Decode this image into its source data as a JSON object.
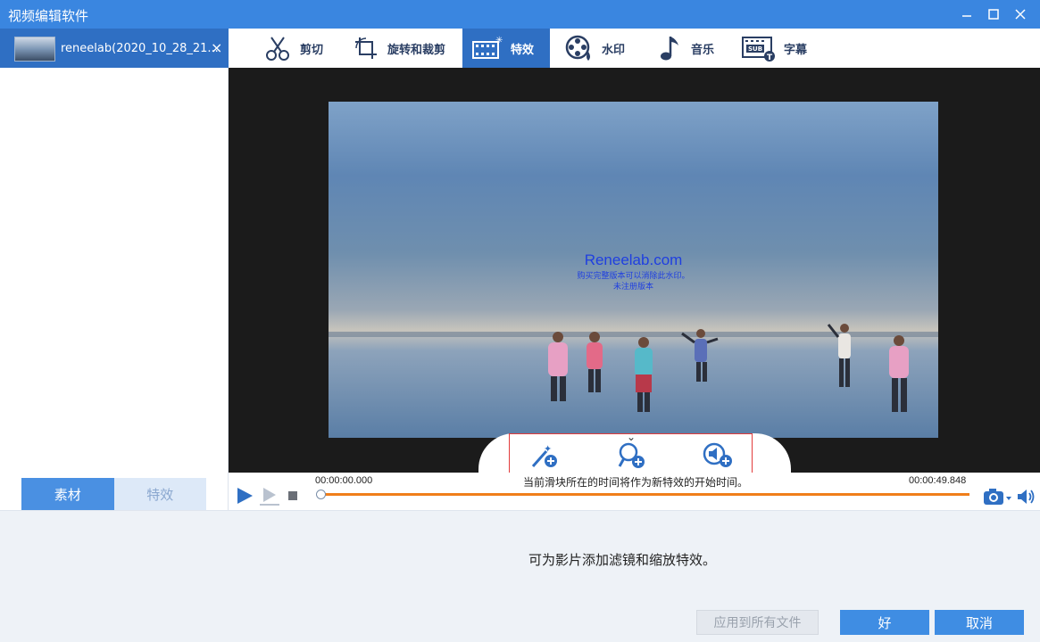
{
  "window": {
    "title": "视频编辑软件"
  },
  "file_tab": {
    "name": "reneelab(2020_10_28_21...",
    "close": "×"
  },
  "toolbar": {
    "items": [
      {
        "label": "剪切",
        "icon": "scissors-icon"
      },
      {
        "label": "旋转和裁剪",
        "icon": "rotate-crop-icon"
      },
      {
        "label": "特效",
        "icon": "effects-icon",
        "active": true
      },
      {
        "label": "水印",
        "icon": "watermark-icon"
      },
      {
        "label": "音乐",
        "icon": "music-note-icon"
      },
      {
        "label": "字幕",
        "icon": "subtitle-icon"
      }
    ]
  },
  "video": {
    "watermark_title": "Reneelab.com",
    "watermark_line1": "购买完整版本可以消除此水印。",
    "watermark_line2": "未注册版本"
  },
  "effect_buttons": [
    "add-filter-icon",
    "add-zoom-icon",
    "add-audio-effect-icon"
  ],
  "player": {
    "time_start": "00:00:00.000",
    "time_end": "00:00:49.848",
    "hint": "当前滑块所在的时间将作为新特效的开始时间。",
    "progress": 0.0
  },
  "left_tabs": {
    "material": "素材",
    "effects": "特效"
  },
  "bottom": {
    "description": "可为影片添加滤镜和缩放特效。",
    "apply_all": "应用到所有文件",
    "ok": "好",
    "cancel": "取消"
  },
  "colors": {
    "accent": "#3a86e0",
    "active_tab": "#2f6fc3",
    "timeline": "#f07e1a"
  }
}
